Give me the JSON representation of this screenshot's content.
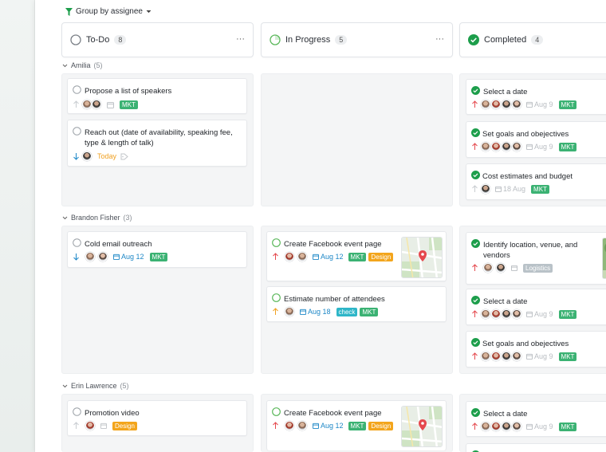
{
  "toolbar": {
    "group_label": "Group by assignee"
  },
  "columns": [
    {
      "title": "To-Do",
      "count": "8",
      "menu": "···"
    },
    {
      "title": "In Progress",
      "count": "5",
      "menu": "···"
    },
    {
      "title": "Completed",
      "count": "4"
    }
  ],
  "groups": [
    {
      "name": "Amilia",
      "count": "(5)"
    },
    {
      "name": "Brandon Fisher",
      "count": "(3)"
    },
    {
      "name": "Erin Lawrence",
      "count": "(5)"
    }
  ],
  "cards": {
    "a_todo_1": {
      "title": "Propose a list of speakers",
      "tag1": "MKT"
    },
    "a_todo_2": {
      "title": "Reach out (date of availability, speaking fee, type & length of talk)",
      "date": "Today"
    },
    "a_done_1": {
      "title": "Select a date",
      "date": "Aug 9",
      "tag1": "MKT"
    },
    "a_done_2": {
      "title": "Set goals and obejectives",
      "date": "Aug 9",
      "tag1": "MKT"
    },
    "a_done_3": {
      "title": "Cost estimates and budget",
      "date": "18 Aug",
      "tag1": "MKT"
    },
    "b_todo_1": {
      "title": "Cold email outreach",
      "date": "Aug 12",
      "tag1": "MKT"
    },
    "b_prog_1": {
      "title": "Create Facebook event page",
      "date": "Aug 12",
      "tag1": "MKT",
      "tag2": "Design"
    },
    "b_prog_2": {
      "title": "Estimate number of attendees",
      "date": "Aug 18",
      "tag1": "check",
      "tag2": "MKT"
    },
    "b_done_1": {
      "title": "Identify location, venue, and vendors",
      "tag1": "Logistics"
    },
    "b_done_2": {
      "title": "Select a date",
      "date": "Aug 9",
      "tag1": "MKT"
    },
    "b_done_3": {
      "title": "Set goals and obejectives",
      "date": "Aug 9",
      "tag1": "MKT"
    },
    "e_todo_1": {
      "title": "Promotion video",
      "tag1": "Design"
    },
    "e_prog_1": {
      "title": "Create Facebook event page",
      "date": "Aug 12",
      "tag1": "MKT",
      "tag2": "Design"
    },
    "e_done_1": {
      "title": "Select a date",
      "date": "Aug 9",
      "tag1": "MKT"
    }
  },
  "colors": {
    "done_green": "#1d9e4b",
    "progress_green": "#5cb85c",
    "mkt_tag": "#3bb273",
    "design_tag": "#f3a51c",
    "check_tag": "#2eb6c8",
    "priority_high": "#e5484d",
    "priority_low": "#1e88c7",
    "priority_medium": "#f0a020"
  },
  "icons": {
    "filter": "filter-icon",
    "todo_status": "empty-circle-icon",
    "progress_status": "progress-circle-icon",
    "done_status": "check-circle-icon",
    "calendar": "calendar-icon",
    "tag": "tag-icon"
  }
}
